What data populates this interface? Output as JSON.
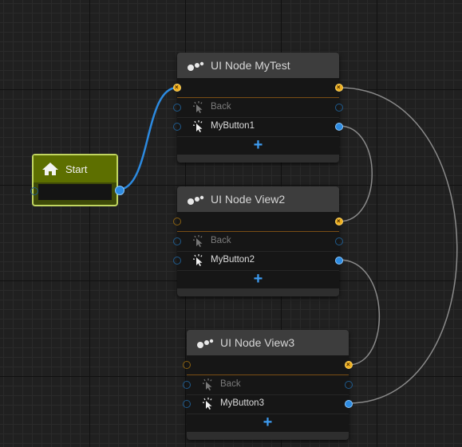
{
  "colors": {
    "canvas": "#202020",
    "node_body": "#161616",
    "node_header": "#3d3d3d",
    "start_green": "#5d6f00",
    "start_border": "#c0d560",
    "flow_blue": "#2c8ae0",
    "exec_orange": "#f0b020",
    "edge_grey": "#8a8a8a"
  },
  "start_node": {
    "title": "Start",
    "icon": "home-icon"
  },
  "nodes": [
    {
      "title": "UI Node MyTest",
      "icon": "node-graph-icon",
      "back_label": "Back",
      "button_label": "MyButton1",
      "add_label": "+"
    },
    {
      "title": "UI Node View2",
      "icon": "node-graph-icon",
      "back_label": "Back",
      "button_label": "MyButton2",
      "add_label": "+"
    },
    {
      "title": "UI Node View3",
      "icon": "node-graph-icon",
      "back_label": "Back",
      "button_label": "MyButton3",
      "add_label": "+"
    }
  ],
  "connections": [
    {
      "from": "Start",
      "to": "UI Node MyTest",
      "kind": "flow"
    },
    {
      "from": "MyButton1",
      "to": "UI Node View2",
      "kind": "button"
    },
    {
      "from": "MyButton2",
      "to": "UI Node View3",
      "kind": "button"
    },
    {
      "from": "MyButton3",
      "to": "UI Node MyTest",
      "kind": "button"
    }
  ]
}
